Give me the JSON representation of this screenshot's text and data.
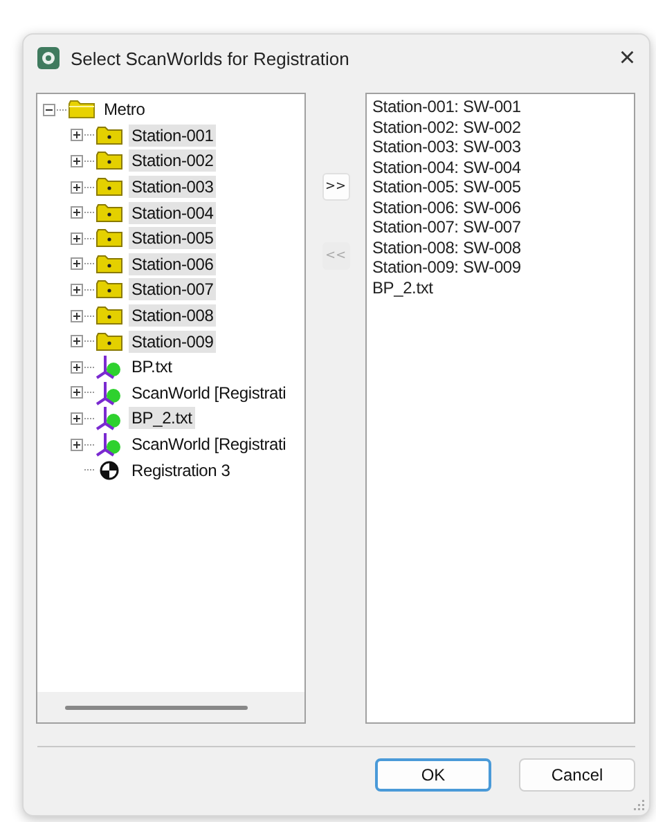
{
  "window": {
    "title": "Select ScanWorlds for Registration",
    "close": "×"
  },
  "tree": {
    "items": [
      {
        "label": "Metro",
        "kind": "folder",
        "expanded": true,
        "selected": false,
        "children": [
          {
            "label": "Station-001",
            "kind": "station",
            "expanded": false,
            "selected": true
          },
          {
            "label": "Station-002",
            "kind": "station",
            "expanded": false,
            "selected": true
          },
          {
            "label": "Station-003",
            "kind": "station",
            "expanded": false,
            "selected": true
          },
          {
            "label": "Station-004",
            "kind": "station",
            "expanded": false,
            "selected": true
          },
          {
            "label": "Station-005",
            "kind": "station",
            "expanded": false,
            "selected": true
          },
          {
            "label": "Station-006",
            "kind": "station",
            "expanded": false,
            "selected": true
          },
          {
            "label": "Station-007",
            "kind": "station",
            "expanded": false,
            "selected": true
          },
          {
            "label": "Station-008",
            "kind": "station",
            "expanded": false,
            "selected": true
          },
          {
            "label": "Station-009",
            "kind": "station",
            "expanded": false,
            "selected": true
          },
          {
            "label": "BP.txt",
            "kind": "scanworld",
            "expanded": false,
            "selected": false
          },
          {
            "label": "ScanWorld [Registrati",
            "kind": "scanworld",
            "expanded": false,
            "selected": false
          },
          {
            "label": "BP_2.txt",
            "kind": "scanworld",
            "expanded": false,
            "selected": true
          },
          {
            "label": "ScanWorld [Registrati",
            "kind": "scanworld",
            "expanded": false,
            "selected": false
          },
          {
            "label": "Registration 3",
            "kind": "registration",
            "selected": false
          }
        ]
      }
    ]
  },
  "move_buttons": [
    {
      "label": ">>",
      "disabled": false
    },
    {
      "label": "<<",
      "disabled": true
    }
  ],
  "selected_list": [
    "Station-001: SW-001",
    "Station-002: SW-002",
    "Station-003: SW-003",
    "Station-004: SW-004",
    "Station-005: SW-005",
    "Station-006: SW-006",
    "Station-007: SW-007",
    "Station-008: SW-008",
    "Station-009: SW-009",
    "BP_2.txt"
  ],
  "buttons": [
    {
      "label": "OK",
      "default": true
    },
    {
      "label": "Cancel",
      "default": false
    }
  ]
}
